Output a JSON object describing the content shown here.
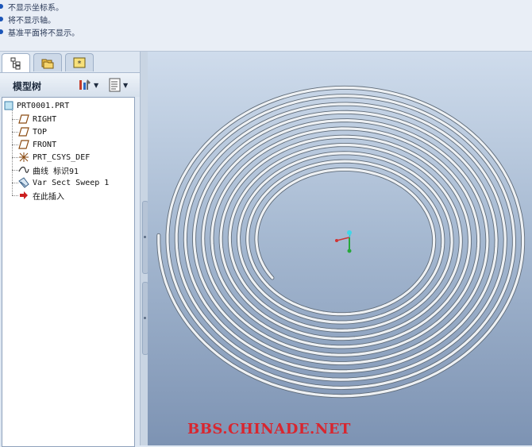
{
  "messages": [
    {
      "text": "不显示坐标系。"
    },
    {
      "text": "将不显示轴。"
    },
    {
      "text": "基准平面将不显示。"
    }
  ],
  "tabs": [
    {
      "icon": "model-tree-tab-icon",
      "active": true
    },
    {
      "icon": "folder-browser-tab-icon",
      "active": false
    },
    {
      "icon": "favorites-tab-icon",
      "active": false
    }
  ],
  "panel": {
    "title": "模型树",
    "settings_icon": "tree-settings-icon",
    "show_icon": "tree-show-icon"
  },
  "tree": {
    "root": "PRT0001.PRT",
    "items": [
      {
        "label": "RIGHT",
        "icon": "datum-plane-icon"
      },
      {
        "label": "TOP",
        "icon": "datum-plane-icon"
      },
      {
        "label": "FRONT",
        "icon": "datum-plane-icon"
      },
      {
        "label": "PRT_CSYS_DEF",
        "icon": "csys-icon"
      },
      {
        "label": "曲线 标识91",
        "icon": "curve-icon"
      },
      {
        "label": "Var Sect Sweep 1",
        "icon": "sweep-icon"
      },
      {
        "label": "在此插入",
        "icon": "insert-here-icon"
      }
    ]
  },
  "watermark": "BBS.CHINADE.NET",
  "colors": {
    "accent": "#1b55b8",
    "watermark": "#d8262f",
    "insert_arrow": "#cc1f1f"
  }
}
